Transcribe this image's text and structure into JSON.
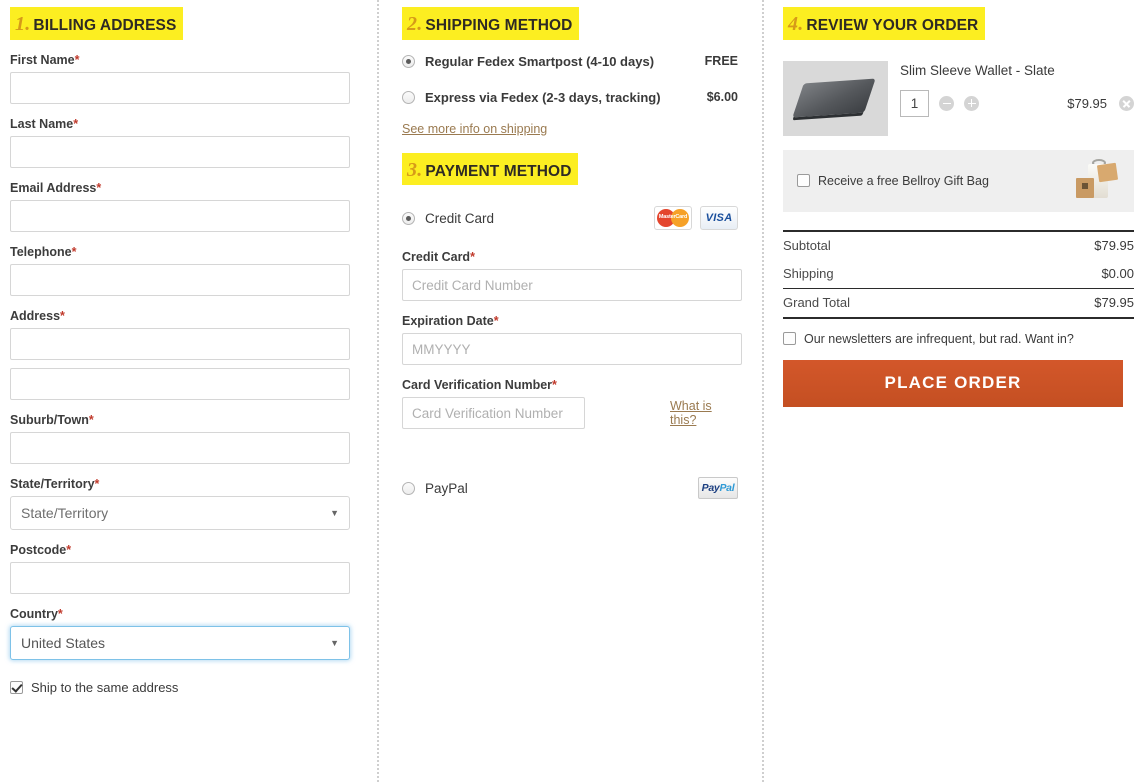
{
  "billing": {
    "section_number": "1.",
    "section_title": "BILLING ADDRESS",
    "fields": [
      {
        "label": "First Name",
        "required": "*",
        "value": "",
        "placeholder": ""
      },
      {
        "label": "Last Name",
        "required": "*",
        "value": "",
        "placeholder": ""
      },
      {
        "label": "Email Address",
        "required": "*",
        "value": "",
        "placeholder": ""
      },
      {
        "label": "Telephone",
        "required": "*",
        "value": "",
        "placeholder": ""
      },
      {
        "label": "Address",
        "required": "*",
        "value": "",
        "placeholder": ""
      },
      {
        "label": "",
        "required": "",
        "value": "",
        "placeholder": ""
      },
      {
        "label": "Suburb/Town",
        "required": "*",
        "value": "",
        "placeholder": ""
      },
      {
        "label": "Postcode",
        "required": "*",
        "value": "",
        "placeholder": ""
      }
    ],
    "state_label": "State/Territory",
    "state_required": "*",
    "state_value": "State/Territory",
    "country_label": "Country",
    "country_required": "*",
    "country_value": "United States",
    "ship_same_label": "Ship to the same address",
    "ship_same_checked": true
  },
  "shipping": {
    "section_number": "2.",
    "section_title": "SHIPPING METHOD",
    "options": [
      {
        "label": "Regular Fedex Smartpost (4-10 days)",
        "price": "FREE",
        "selected": true
      },
      {
        "label": "Express via Fedex (2-3 days, tracking)",
        "price": "$6.00",
        "selected": false
      }
    ],
    "more_info_link": "See more info on shipping"
  },
  "payment": {
    "section_number": "3.",
    "section_title": "PAYMENT METHOD",
    "credit_card_option": "Credit Card",
    "credit_card_selected": true,
    "card_logos": [
      "MasterCard",
      "VISA"
    ],
    "mastercard_text": "MasterCard",
    "visa_text": "VISA",
    "fields": [
      {
        "label": "Credit Card",
        "required": "*",
        "placeholder": "Credit Card Number",
        "value": ""
      },
      {
        "label": "Expiration Date",
        "required": "*",
        "placeholder": "MMYYYY",
        "value": ""
      },
      {
        "label": "Card Verification Number",
        "required": "*",
        "placeholder": "Card Verification Number",
        "value": ""
      }
    ],
    "what_is_this_link": "What is this?",
    "paypal_option": "PayPal",
    "paypal_selected": false,
    "paypal_logo_a": "Pay",
    "paypal_logo_b": "Pal"
  },
  "review": {
    "section_number": "4.",
    "section_title": "REVIEW YOUR ORDER",
    "product": {
      "name": "Slim Sleeve Wallet - Slate",
      "quantity": "1",
      "price": "$79.95"
    },
    "gift_bag_label": "Receive a free Bellroy Gift Bag",
    "gift_bag_checked": false,
    "totals": [
      {
        "label": "Subtotal",
        "value": "$79.95"
      },
      {
        "label": "Shipping",
        "value": "$0.00"
      }
    ],
    "grand_total_label": "Grand Total",
    "grand_total_value": "$79.95",
    "newsletter_label": "Our newsletters are infrequent, but rad. Want in?",
    "newsletter_checked": false,
    "place_order_label": "PLACE ORDER"
  },
  "colors": {
    "highlight": "#fcee21",
    "section_number": "#d69a19",
    "required_asterisk": "#c0392b",
    "link": "#9a7a50",
    "place_order_button": "#c9532a",
    "focus_border": "#7ec2e8"
  }
}
